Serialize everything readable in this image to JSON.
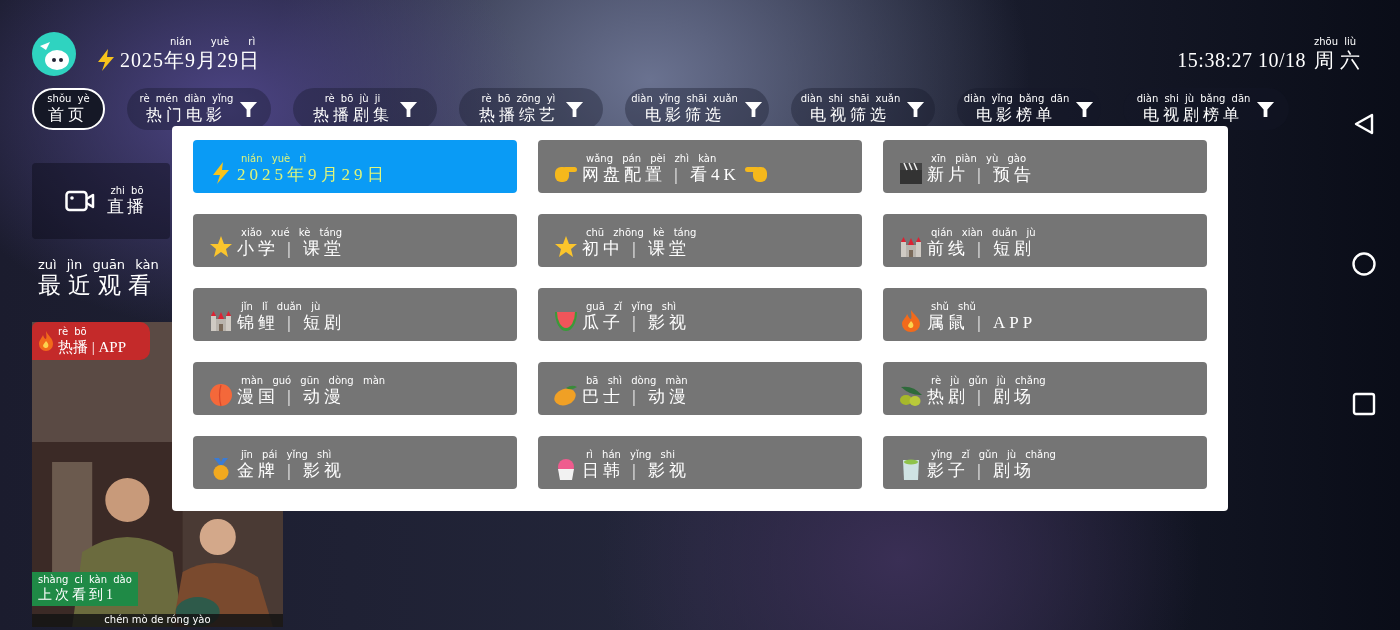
{
  "header": {
    "date": {
      "pinyin": "nián yuè rì",
      "text": "2025年9月29日"
    },
    "clock": {
      "time": "15:38:27 10/18",
      "weekday": {
        "pinyin": "zhōu liù",
        "text": "周六"
      }
    }
  },
  "tabs": [
    {
      "kind": "home",
      "selected": true,
      "label": {
        "pinyin": "shǒu yè",
        "text": "首页"
      }
    },
    {
      "kind": "filter",
      "selected": false,
      "label": {
        "pinyin": "rè mén diàn yǐng",
        "text": "热门电影"
      }
    },
    {
      "kind": "filter",
      "selected": false,
      "label": {
        "pinyin": "rè bō jù ji",
        "text": "热播剧集"
      }
    },
    {
      "kind": "filter",
      "selected": false,
      "label": {
        "pinyin": "rè bō zōng yì",
        "text": "热播综艺"
      }
    },
    {
      "kind": "filter",
      "selected": false,
      "label": {
        "pinyin": "diàn yǐng shāi xuǎn",
        "text": "电影筛选"
      }
    },
    {
      "kind": "filter",
      "selected": false,
      "label": {
        "pinyin": "diàn shi shāi xuǎn",
        "text": "电视筛选"
      }
    },
    {
      "kind": "filter",
      "selected": false,
      "label": {
        "pinyin": "diàn yǐng bǎng dān",
        "text": "电影榜单"
      }
    },
    {
      "kind": "filter",
      "selected": false,
      "label": {
        "pinyin": "diàn shi jù bǎng dān",
        "text": "电视剧榜单"
      }
    }
  ],
  "live": {
    "label": {
      "pinyin": "zhi bō",
      "text": "直播"
    }
  },
  "recent_heading": {
    "pinyin": "zuì jìn guān kàn",
    "text": "最近观看"
  },
  "poster": {
    "badge": {
      "pinyin": "rè bō",
      "text": "热播 | APP"
    },
    "progress": {
      "pinyin": "shàng ci kàn dào",
      "text": "上次看到1"
    },
    "caption": "chén mò de róng yào"
  },
  "menu": [
    {
      "selected": true,
      "label": {
        "pinyin": "nián yuè rì",
        "text": "2025年9月29日"
      }
    },
    {
      "selected": false,
      "label": {
        "pinyin": "wǎng pán pèi zhì kàn",
        "text": "网盘配置 | 看4K"
      }
    },
    {
      "selected": false,
      "label": {
        "pinyin": "xīn piàn yù gào",
        "text": "新片 | 预告"
      }
    },
    {
      "selected": false,
      "label": {
        "pinyin": "xiǎo xué kè táng",
        "text": "小学 | 课堂"
      }
    },
    {
      "selected": false,
      "label": {
        "pinyin": "chū zhōng kè táng",
        "text": "初中 | 课堂"
      }
    },
    {
      "selected": false,
      "label": {
        "pinyin": "qián xiàn duǎn jù",
        "text": "前线 | 短剧"
      }
    },
    {
      "selected": false,
      "label": {
        "pinyin": "jǐn lǐ duǎn jù",
        "text": "锦鲤 | 短剧"
      }
    },
    {
      "selected": false,
      "label": {
        "pinyin": "guā zǐ yǐng shì",
        "text": "瓜子 | 影视"
      }
    },
    {
      "selected": false,
      "label": {
        "pinyin": "shǔ shǔ",
        "text": "属鼠 | APP"
      }
    },
    {
      "selected": false,
      "label": {
        "pinyin": "màn guó gūn dòng màn",
        "text": "漫国 | 动漫"
      }
    },
    {
      "selected": false,
      "label": {
        "pinyin": "bā shì dòng màn",
        "text": "巴士 | 动漫"
      }
    },
    {
      "selected": false,
      "label": {
        "pinyin": "rè jù gǔn jù chǎng",
        "text": "热剧 | 剧场"
      }
    },
    {
      "selected": false,
      "label": {
        "pinyin": "jīn pái yǐng shì",
        "text": "金牌 | 影视"
      }
    },
    {
      "selected": false,
      "label": {
        "pinyin": "rì hán yǐng shi",
        "text": "日韩 | 影视"
      }
    },
    {
      "selected": false,
      "label": {
        "pinyin": "yǐng zǐ gǔn jù chǎng",
        "text": "影子 | 剧场"
      }
    }
  ]
}
